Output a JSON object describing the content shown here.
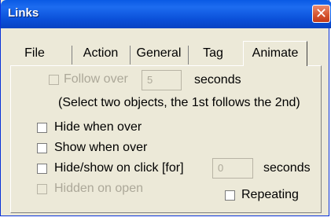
{
  "window": {
    "title": "Links",
    "close_glyph": "✕"
  },
  "tabs": [
    {
      "label": "File"
    },
    {
      "label": "Action"
    },
    {
      "label": "General"
    },
    {
      "label": "Tag"
    },
    {
      "label": "Animate",
      "active": true
    }
  ],
  "animate": {
    "follow_over": {
      "label": "Follow over",
      "value": "5",
      "unit": "seconds",
      "enabled": false,
      "checked": false
    },
    "instruction": "(Select two objects, the 1st follows the 2nd)",
    "hide_when_over": {
      "label": "Hide when over",
      "checked": false
    },
    "show_when_over": {
      "label": "Show when over",
      "checked": false
    },
    "hide_show_on_click": {
      "label": "Hide/show on click [for]",
      "value": "0",
      "unit": "seconds",
      "checked": false
    },
    "hidden_on_open": {
      "label": "Hidden on open",
      "enabled": false,
      "checked": false
    },
    "repeating": {
      "label": "Repeating",
      "checked": false
    }
  }
}
